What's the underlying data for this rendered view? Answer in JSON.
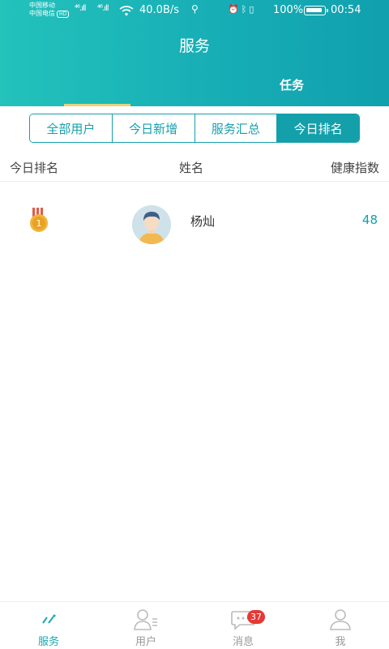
{
  "status_bar": {
    "carrier_1": "中国移动",
    "carrier_2": "中国电信",
    "hd_tag": "HD",
    "signal_1": "⁴⁶.ıll",
    "signal_2": "⁴⁶.ıll",
    "net_speed": "40.0B/s",
    "battery_percent": "100%",
    "time": "00:54"
  },
  "header": {
    "title": "服务",
    "tabs": [
      {
        "label": "",
        "active": true
      },
      {
        "label": "任务",
        "active": false
      }
    ]
  },
  "filter": {
    "options": [
      "全部用户",
      "今日新增",
      "服务汇总",
      "今日排名"
    ],
    "selected": "今日排名"
  },
  "table": {
    "columns": {
      "rank": "今日排名",
      "name": "姓名",
      "score": "健康指数"
    },
    "rows": [
      {
        "rank": "1",
        "name": "杨灿",
        "score": "48"
      }
    ]
  },
  "bottom_nav": {
    "items": [
      {
        "label": "服务",
        "icon": "service-icon",
        "active": true
      },
      {
        "label": "用户",
        "icon": "users-icon",
        "active": false
      },
      {
        "label": "消息",
        "icon": "message-icon",
        "active": false,
        "badge": "37"
      },
      {
        "label": "我",
        "icon": "profile-icon",
        "active": false
      }
    ]
  },
  "colors": {
    "accent": "#14a0ab",
    "header_start": "#23c2bb",
    "header_end": "#10a0ae",
    "tab_indicator": "#e8d27a",
    "badge": "#e53935",
    "medal": "#f0b43a"
  }
}
